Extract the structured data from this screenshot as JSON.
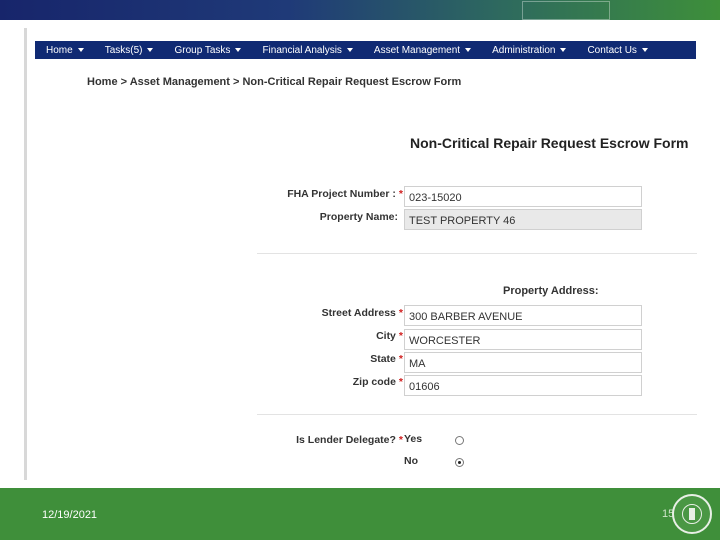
{
  "nav": {
    "items": [
      {
        "label": "Home"
      },
      {
        "label": "Tasks(5)"
      },
      {
        "label": "Group Tasks"
      },
      {
        "label": "Financial Analysis"
      },
      {
        "label": "Asset Management"
      },
      {
        "label": "Administration"
      },
      {
        "label": "Contact Us"
      }
    ]
  },
  "breadcrumb": "Home > Asset Management > Non-Critical Repair Request Escrow Form",
  "form": {
    "title": "Non-Critical Repair Request Escrow Form",
    "required_marker": "*",
    "fha_label": "FHA Project Number :",
    "fha_value": "023-15020",
    "property_name_label": "Property Name:",
    "property_name_value": "TEST PROPERTY 46",
    "address_heading": "Property Address:",
    "street_label": "Street Address",
    "street_value": "300 BARBER AVENUE",
    "city_label": "City",
    "city_value": "WORCESTER",
    "state_label": "State",
    "state_value": "MA",
    "zip_label": "Zip code",
    "zip_value": "01606",
    "delegate_label": "Is Lender Delegate?",
    "yes_label": "Yes",
    "no_label": "No"
  },
  "footer": {
    "date": "12/19/2021",
    "page": "15"
  },
  "colors": {
    "navbar": "#102a73",
    "footer": "#3f8f3a",
    "required": "#d02020"
  }
}
